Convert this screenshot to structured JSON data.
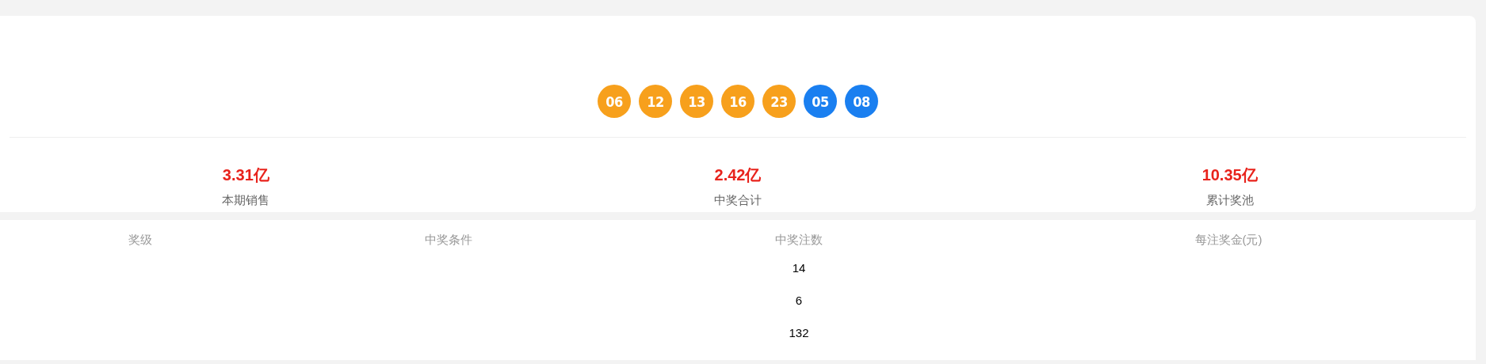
{
  "balls": [
    {
      "number": "06",
      "color": "#f7a01c"
    },
    {
      "number": "12",
      "color": "#f7a01c"
    },
    {
      "number": "13",
      "color": "#f7a01c"
    },
    {
      "number": "16",
      "color": "#f7a01c"
    },
    {
      "number": "23",
      "color": "#f7a01c"
    },
    {
      "number": "05",
      "color": "#1a7ff0"
    },
    {
      "number": "08",
      "color": "#1a7ff0"
    }
  ],
  "stats": [
    {
      "value": "3.31亿",
      "label": "本期销售"
    },
    {
      "value": "2.42亿",
      "label": "中奖合计"
    },
    {
      "value": "10.35亿",
      "label": "累计奖池"
    }
  ],
  "table": {
    "columns": [
      "奖级",
      "中奖条件",
      "中奖注数",
      "每注奖金(元)"
    ],
    "rows": [
      [
        "",
        "",
        "14",
        ""
      ],
      [
        "",
        "",
        "6",
        ""
      ],
      [
        "",
        "",
        "132",
        ""
      ]
    ]
  }
}
